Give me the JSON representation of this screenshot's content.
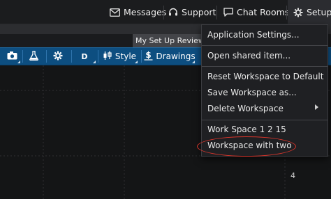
{
  "topbar": {
    "messages": "Messages",
    "support": "Support",
    "chat_rooms": "Chat Rooms",
    "setup": "Setup"
  },
  "review_bar": {
    "label": "My Set Up Review"
  },
  "toolbar": {
    "period": "D",
    "style": "Style",
    "drawings": "Drawings"
  },
  "chart": {
    "axis_value": "4"
  },
  "setup_menu": {
    "items": [
      {
        "label": "Application Settings..."
      },
      {
        "label": "Open shared item..."
      },
      {
        "label": "Reset Workspace to Default"
      },
      {
        "label": "Save Workspace as..."
      },
      {
        "label": "Delete Workspace"
      },
      {
        "label": "Work Space 1 2 15"
      },
      {
        "label": "Workspace with two"
      }
    ]
  },
  "colors": {
    "toolbar": "#0d4e80",
    "highlight_ring": "#d9352b",
    "menu_bg": "#1f2023"
  }
}
